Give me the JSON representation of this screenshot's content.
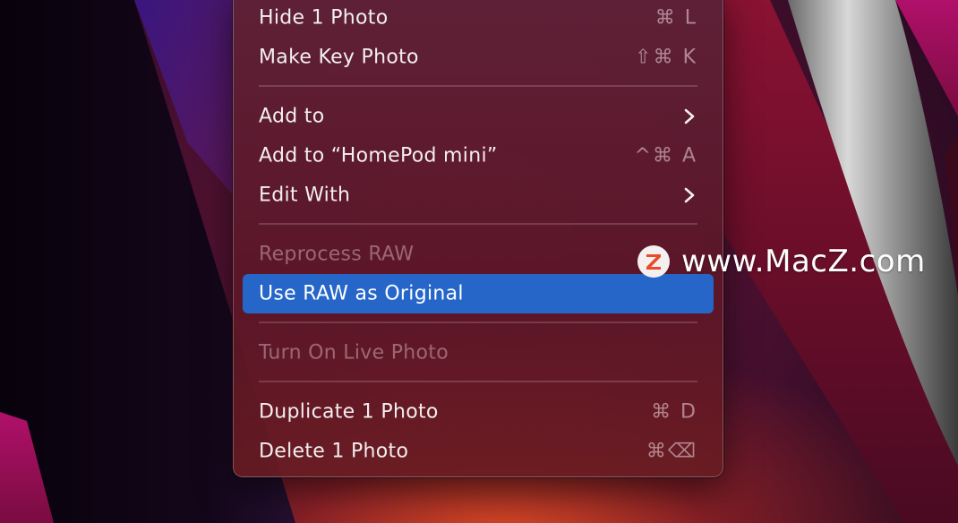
{
  "colors": {
    "menu_background": "#5c1a2e",
    "selection": "#2566c8",
    "text": "#f3eef0",
    "disabled_text": "#a0737f",
    "shortcut_text": "#b88e9c"
  },
  "menu": {
    "items": [
      {
        "label": "Hide 1 Photo",
        "shortcut": "⌘ L",
        "state": "normal"
      },
      {
        "label": "Make Key Photo",
        "shortcut": "⇧⌘ K",
        "state": "normal"
      },
      {
        "label": "Add to",
        "submenu": "chevron-right-icon",
        "state": "normal"
      },
      {
        "label": "Add to “HomePod mini”",
        "shortcut": "^⌘ A",
        "state": "normal"
      },
      {
        "label": "Edit With",
        "submenu": "chevron-right-icon",
        "state": "normal"
      },
      {
        "label": "Reprocess RAW",
        "state": "disabled"
      },
      {
        "label": "Use RAW as Original",
        "state": "selected"
      },
      {
        "label": "Turn On Live Photo",
        "state": "disabled"
      },
      {
        "label": "Duplicate 1 Photo",
        "shortcut": "⌘ D",
        "state": "normal"
      },
      {
        "label": "Delete 1 Photo",
        "shortcut": "⌘⌫",
        "state": "normal"
      }
    ]
  },
  "watermark": {
    "text": "www.MacZ.com",
    "logo_letter": "Z",
    "logo_icon": "macz-logo-icon"
  }
}
